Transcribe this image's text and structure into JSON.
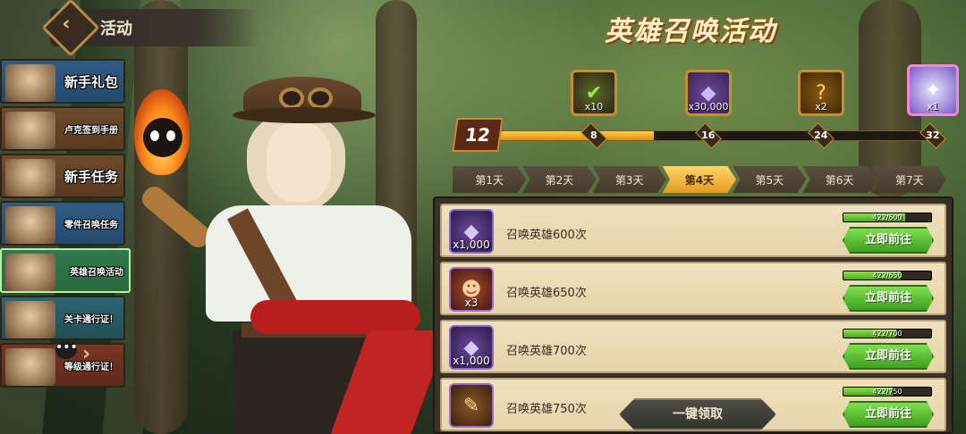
{
  "header": {
    "title": "活动"
  },
  "side_menu": [
    {
      "label": "新手礼包",
      "style": "blue"
    },
    {
      "label": "卢克签到手册",
      "style": "brown"
    },
    {
      "label": "新手任务",
      "style": "brown"
    },
    {
      "label": "零件召唤任务",
      "style": "blue"
    },
    {
      "label": "英雄召唤活动",
      "style": "green",
      "active": true
    },
    {
      "label": "关卡通行证！",
      "style": "teal"
    },
    {
      "label": "等级通行证！",
      "style": "red"
    }
  ],
  "event_title": "英雄召唤活动",
  "progress": {
    "current_level": "12",
    "fill_fraction": 0.37,
    "milestones": [
      {
        "marker": "8",
        "qty": "x10",
        "icon": "check-icon",
        "style": "green"
      },
      {
        "marker": "16",
        "qty": "x30,000",
        "icon": "diamond-icon",
        "style": "purple"
      },
      {
        "marker": "24",
        "qty": "x2",
        "icon": "key-icon",
        "style": "gold"
      },
      {
        "marker": "32",
        "qty": "x1",
        "icon": "crystal-icon",
        "style": "pink"
      }
    ]
  },
  "day_tabs": [
    {
      "label": "第1天"
    },
    {
      "label": "第2天"
    },
    {
      "label": "第3天"
    },
    {
      "label": "第4天",
      "active": true
    },
    {
      "label": "第5天"
    },
    {
      "label": "第6天"
    },
    {
      "label": "第7天"
    }
  ],
  "tasks": [
    {
      "title": "召唤英雄600次",
      "progress": "422/600",
      "fraction": 0.703,
      "reward_qty": "x1,000",
      "icon": "diamond-icon",
      "button": "立即前往"
    },
    {
      "title": "召唤英雄650次",
      "progress": "422/650",
      "fraction": 0.649,
      "reward_qty": "x3",
      "icon": "hero-token-icon",
      "button": "立即前往"
    },
    {
      "title": "召唤英雄700次",
      "progress": "422/700",
      "fraction": 0.603,
      "reward_qty": "x1,000",
      "icon": "diamond-icon",
      "button": "立即前往"
    },
    {
      "title": "召唤英雄750次",
      "progress": "422/750",
      "fraction": 0.563,
      "reward_qty": "",
      "icon": "scroll-icon",
      "button": "立即前往"
    }
  ],
  "claim_all": "一键领取"
}
